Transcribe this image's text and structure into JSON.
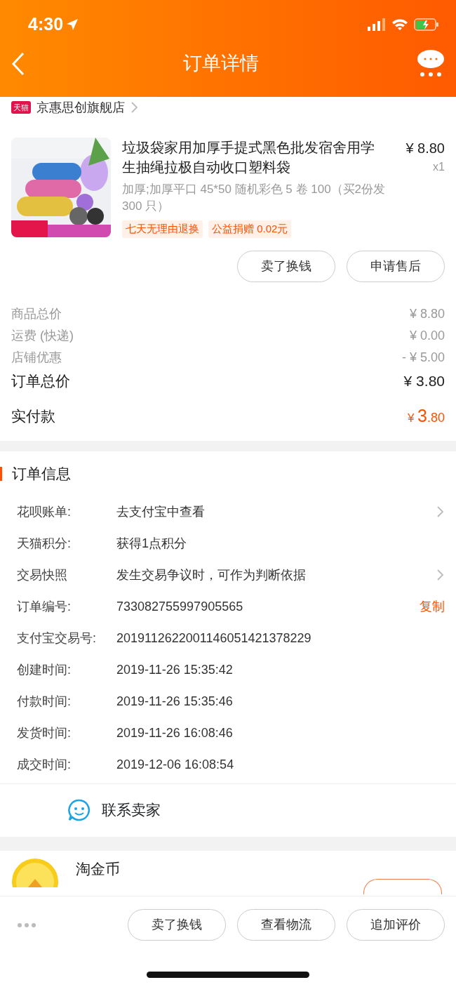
{
  "status_bar": {
    "time": "4:30"
  },
  "header": {
    "title": "订单详情"
  },
  "store": {
    "badge": "天猫",
    "name": "京惠思创旗舰店"
  },
  "product": {
    "kind": "picture",
    "title": "垃圾袋家用加厚手提式黑色批发宿舍用学生抽绳拉极自动收口塑料袋",
    "price": "¥ 8.80",
    "quantity": "x1",
    "spec": "加厚;加厚平口 45*50 随机彩色 5 卷 100（买2份发 300 只）",
    "tags": [
      "七天无理由退换",
      "公益捐赠 0.02元"
    ]
  },
  "item_actions": [
    "卖了换钱",
    "申请售后"
  ],
  "summary": [
    {
      "label": "商品总价",
      "value": "¥ 8.80",
      "kind": "minor"
    },
    {
      "label": "运费 (快递)",
      "value": "¥ 0.00",
      "kind": "minor"
    },
    {
      "label": "店铺优惠",
      "value": "- ¥ 5.00",
      "kind": "minor"
    },
    {
      "label": "订单总价",
      "value": "¥ 3.80",
      "kind": "major"
    }
  ],
  "paid": {
    "label": "实付款",
    "currency": "¥ ",
    "integer": "3",
    "decimal": ".80"
  },
  "order_info": {
    "title": "订单信息",
    "rows": [
      {
        "label": "花呗账单:",
        "value": "去支付宝中查看",
        "kind": "link"
      },
      {
        "label": "天猫积分:",
        "value": "获得1点积分",
        "kind": "plain"
      },
      {
        "label": "交易快照",
        "value": "发生交易争议时，可作为判断依据",
        "kind": "link"
      },
      {
        "label": "订单编号:",
        "value": "733082755997905565",
        "kind": "copy",
        "action": "复制"
      },
      {
        "label": "支付宝交易号:",
        "value": "2019112622001146051421378229",
        "kind": "plain"
      },
      {
        "label": "创建时间:",
        "value": "2019-11-26 15:35:42",
        "kind": "plain"
      },
      {
        "label": "付款时间:",
        "value": "2019-11-26 15:35:46",
        "kind": "plain"
      },
      {
        "label": "发货时间:",
        "value": "2019-11-26 16:08:46",
        "kind": "plain"
      },
      {
        "label": "成交时间:",
        "value": "2019-12-06 16:08:54",
        "kind": "plain"
      }
    ]
  },
  "contact": {
    "label": "联系卖家"
  },
  "coin": {
    "title": "淘金币"
  },
  "bottom_actions": [
    "卖了换钱",
    "查看物流",
    "追加评价"
  ]
}
